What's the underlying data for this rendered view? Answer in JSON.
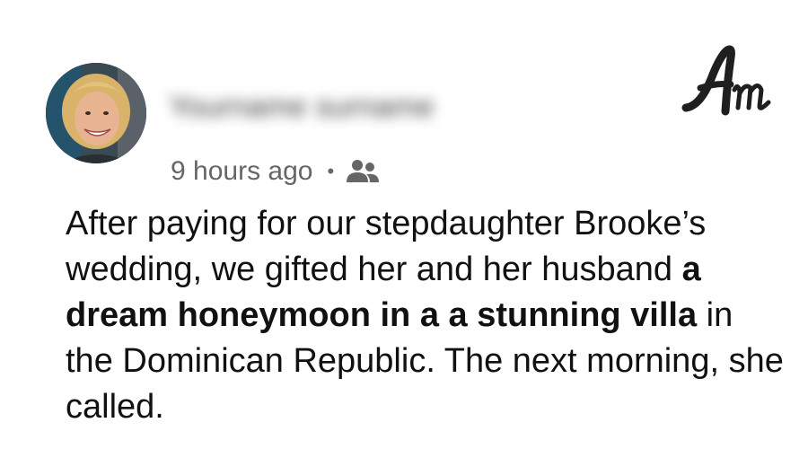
{
  "post": {
    "username": "Yourname surname",
    "timestamp": "9 hours ago",
    "separator": "•",
    "audience_icon": "friends-icon",
    "brand_logo_text": "Am",
    "story": {
      "part1": "After paying for our stepdaughter Brooke’s wedding, we gifted her and her husband ",
      "bold1": "a dream honeymoon in a a stunning villa",
      "part2": " in the Dominican Republic. The next morning, she called."
    }
  },
  "colors": {
    "text": "#111111",
    "meta": "#666666",
    "background": "#ffffff",
    "logo": "#1f1f1f"
  }
}
